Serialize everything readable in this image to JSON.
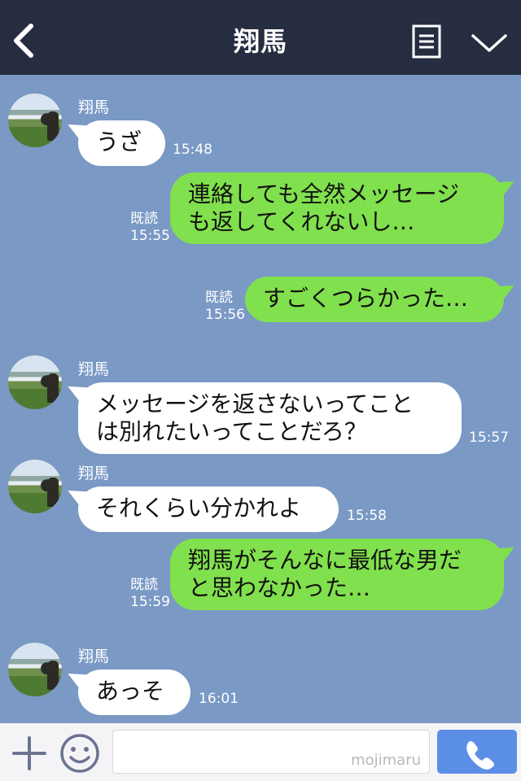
{
  "header": {
    "title": "翔馬"
  },
  "messages": [
    {
      "sender": "翔馬",
      "text": "うざ",
      "time": "15:48"
    },
    {
      "text": "連絡しても全然メッセージ\nも返してくれないし…",
      "read": "既読",
      "time": "15:55"
    },
    {
      "text": "すごくつらかった…",
      "read": "既読",
      "time": "15:56"
    },
    {
      "sender": "翔馬",
      "text": "メッセージを返さないってこと\nは別れたいってことだろ？",
      "time": "15:57"
    },
    {
      "sender": "翔馬",
      "text": "それくらい分かれよ",
      "time": "15:58"
    },
    {
      "text": "翔馬がそんなに最低な男だ\nと思わなかった…",
      "read": "既読",
      "time": "15:59"
    },
    {
      "sender": "翔馬",
      "text": "あっそ",
      "time": "16:01"
    }
  ],
  "input": {
    "watermark": "mojimaru",
    "value": ""
  },
  "colors": {
    "header": "#262d40",
    "chat_bg": "#7a99c5",
    "outgoing": "#81e04d",
    "send": "#5b8fe5"
  },
  "icons": [
    "back-arrow-icon",
    "menu-list-icon",
    "chevron-down-icon",
    "plus-icon",
    "smiley-icon",
    "phone-icon"
  ]
}
